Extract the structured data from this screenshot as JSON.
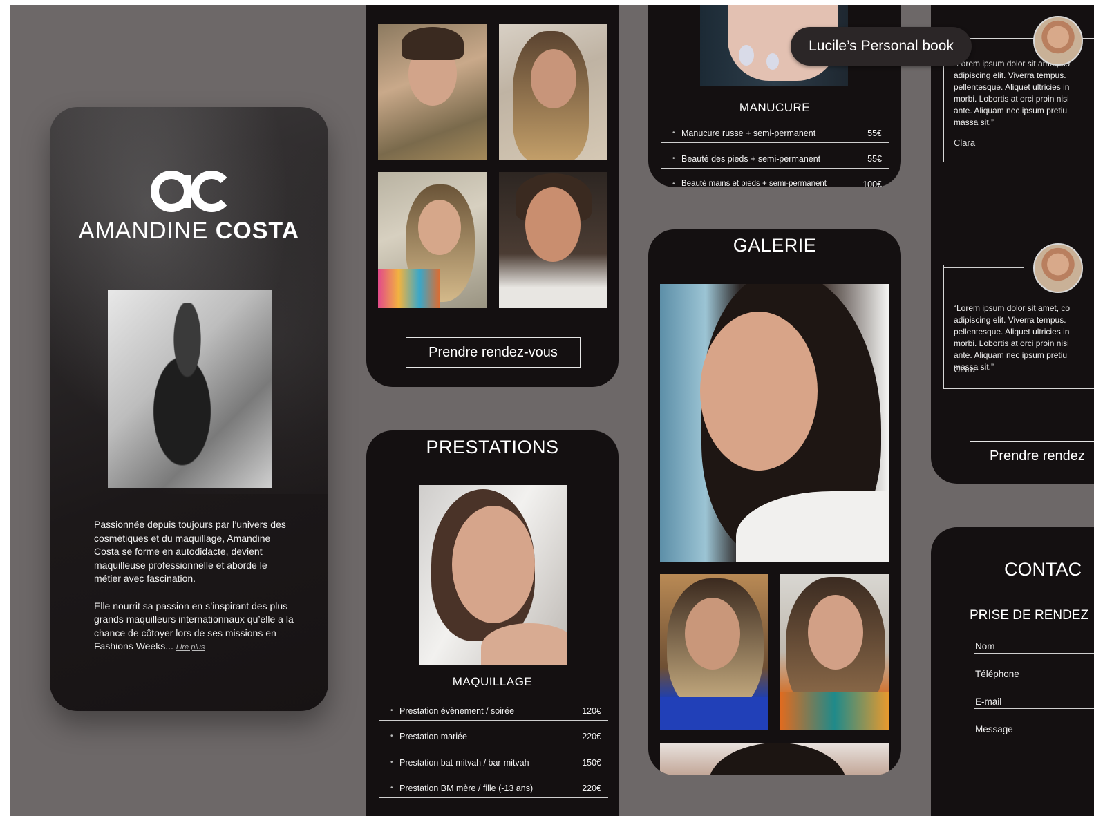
{
  "brand": {
    "monogram": "ac",
    "name_light": "AMANDINE",
    "name_bold": "COSTA"
  },
  "hero": {
    "paragraph_1": "Passionnée depuis toujours par l’univers des cosmétiques et du maquillage, Amandine Costa se forme en autodidacte, devient maquilleuse professionnelle et aborde le métier avec fascination.",
    "paragraph_2": "Elle nourrit sa passion en s’inspirant des plus grands maquilleurs internationnaux qu’elle a la chance de côtoyer lors de ses missions en Fashions Weeks...",
    "read_more": "Lire plus"
  },
  "gallery_top": {
    "cta": "Prendre rendez-vous"
  },
  "prestations": {
    "title": "PRESTATIONS",
    "subtitle": "MAQUILLAGE",
    "items": [
      {
        "label": "Prestation évènement / soirée",
        "price": "120€"
      },
      {
        "label": "Prestation mariée",
        "price": "220€"
      },
      {
        "label": "Prestation bat-mitvah / bar-mitvah",
        "price": "150€"
      },
      {
        "label": "Prestation BM mère / fille (-13 ans)",
        "price": "220€"
      }
    ]
  },
  "manucure": {
    "title": "MANUCURE",
    "items": [
      {
        "label": "Manucure russe + semi-permanent",
        "price": "55€"
      },
      {
        "label": "Beauté des pieds + semi-permanent",
        "price": "55€"
      },
      {
        "label": "Beauté mains et pieds + semi-permanent",
        "price": "100€"
      }
    ]
  },
  "galerie": {
    "title": "GALERIE"
  },
  "testimonials": {
    "items": [
      {
        "lines": [
          "“Lorem ipsum dolor sit amet, co",
          "adipiscing elit. Viverra tempus.",
          "pellentesque. Aliquet ultricies in",
          "morbi. Lobortis at orci proin nisi",
          "ante. Aliquam nec ipsum pretiu",
          "massa sit.”"
        ],
        "author": "Clara"
      },
      {
        "lines": [
          "“Lorem ipsum dolor sit amet, co",
          "adipiscing elit. Viverra tempus.",
          "pellentesque. Aliquet ultricies in",
          "morbi. Lobortis at orci proin nisi",
          "ante. Aliquam nec ipsum pretiu",
          "massa sit.”"
        ],
        "author": "Clara"
      }
    ],
    "cta": "Prendre rendez"
  },
  "contact": {
    "title": "CONTAC",
    "subtitle": "PRISE DE RENDEZ",
    "fields": {
      "name": "Nom",
      "phone": "Téléphone",
      "email": "E-mail",
      "message": "Message"
    }
  },
  "overlay": {
    "pill": "Lucile’s Personal book"
  },
  "colors": {
    "canvas": "#6d6868",
    "card": "#141011",
    "text": "#ffffff"
  }
}
